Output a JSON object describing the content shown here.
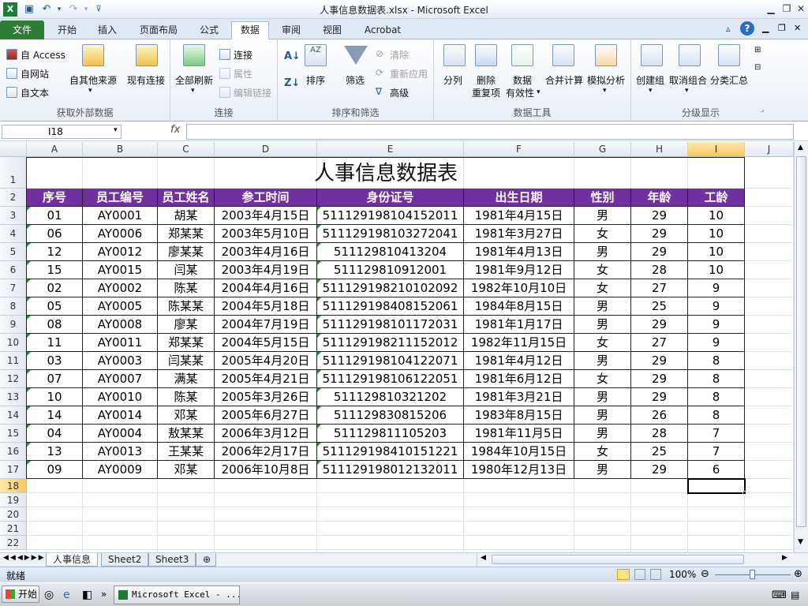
{
  "window": {
    "title": "人事信息数据表.xlsx - Microsoft Excel"
  },
  "tabs": [
    "文件",
    "开始",
    "插入",
    "页面布局",
    "公式",
    "数据",
    "审阅",
    "视图",
    "Acrobat"
  ],
  "ribbon": {
    "ext_group": {
      "label": "获取外部数据",
      "access": "自 Access",
      "web": "自网站",
      "text": "自文本",
      "other": "自其他来源",
      "existing": "现有连接"
    },
    "conn_group": {
      "label": "连接",
      "refresh_all": "全部刷新",
      "connections": "连接",
      "properties": "属性",
      "edit_links": "编辑链接"
    },
    "sort_group": {
      "label": "排序和筛选",
      "sort": "排序",
      "filter": "筛选",
      "clear": "清除",
      "reapply": "重新应用",
      "advanced": "高级"
    },
    "tools_group": {
      "label": "数据工具",
      "split": "分列",
      "remove_dup_1": "删除",
      "remove_dup_2": "重复项",
      "validation_1": "数据",
      "validation_2": "有效性",
      "consolidate": "合并计算",
      "whatif": "模拟分析"
    },
    "outline_group": {
      "label": "分级显示",
      "group": "创建组",
      "ungroup": "取消组合",
      "subtotal": "分类汇总"
    }
  },
  "formula_bar": {
    "name_box": "I18",
    "fx": "fx",
    "content": ""
  },
  "columns": [
    "A",
    "B",
    "C",
    "D",
    "E",
    "F",
    "G",
    "H",
    "I",
    "J"
  ],
  "rows": [
    "1",
    "2",
    "3",
    "4",
    "5",
    "6",
    "7",
    "8",
    "9",
    "10",
    "11",
    "12",
    "13",
    "14",
    "15",
    "16",
    "17",
    "18",
    "19",
    "20",
    "21",
    "22"
  ],
  "sheet": {
    "title": "人事信息数据表",
    "headers": [
      "序号",
      "员工编号",
      "员工姓名",
      "参工时间",
      "身份证号",
      "出生日期",
      "性别",
      "年龄",
      "工龄"
    ],
    "records": [
      [
        "01",
        "AY0001",
        "胡某",
        "2003年4月15日",
        "511129198104152011",
        "1981年4月15日",
        "男",
        "29",
        "10"
      ],
      [
        "06",
        "AY0006",
        "郑某某",
        "2003年5月10日",
        "511129198103272041",
        "1981年3月27日",
        "女",
        "29",
        "10"
      ],
      [
        "12",
        "AY0012",
        "廖某某",
        "2003年4月16日",
        "51112981041320 4",
        "1981年4月13日",
        "男",
        "29",
        "10"
      ],
      [
        "15",
        "AY0015",
        "闫某",
        "2003年4月19日",
        "511129810912001",
        "1981年9月12日",
        "女",
        "28",
        "10"
      ],
      [
        "02",
        "AY0002",
        "陈某",
        "2004年4月16日",
        "511129198210102092",
        "1982年10月10日",
        "女",
        "27",
        "9"
      ],
      [
        "05",
        "AY0005",
        "陈某某",
        "2004年5月18日",
        "511129198408152061",
        "1984年8月15日",
        "男",
        "25",
        "9"
      ],
      [
        "08",
        "AY0008",
        "廖某",
        "2004年7月19日",
        "511129198101172031",
        "1981年1月17日",
        "男",
        "29",
        "9"
      ],
      [
        "11",
        "AY0011",
        "郑某某",
        "2004年5月15日",
        "511129198211152012",
        "1982年11月15日",
        "女",
        "27",
        "9"
      ],
      [
        "03",
        "AY0003",
        "闫某某",
        "2005年4月20日",
        "511129198104122071",
        "1981年4月12日",
        "男",
        "29",
        "8"
      ],
      [
        "07",
        "AY0007",
        "满某",
        "2005年4月21日",
        "511129198106122051",
        "1981年6月12日",
        "女",
        "29",
        "8"
      ],
      [
        "10",
        "AY0010",
        "陈某",
        "2005年3月26日",
        "511129810321202",
        "1981年3月21日",
        "男",
        "29",
        "8"
      ],
      [
        "14",
        "AY0014",
        "邓某",
        "2005年6月27日",
        "511129830815206",
        "1983年8月15日",
        "男",
        "26",
        "8"
      ],
      [
        "04",
        "AY0004",
        "敖某某",
        "2006年3月12日",
        "511129811105203",
        "1981年11月5日",
        "男",
        "28",
        "7"
      ],
      [
        "13",
        "AY0013",
        "王某某",
        "2006年2月17日",
        "511129198410151221",
        "1984年10月15日",
        "女",
        "25",
        "7"
      ],
      [
        "09",
        "AY0009",
        "邓某",
        "2006年10月8日",
        "511129198012132011",
        "1980年12月13日",
        "男",
        "29",
        "6"
      ]
    ]
  },
  "sheet_tabs": [
    "人事信息",
    "Sheet2",
    "Sheet3"
  ],
  "status": {
    "ready": "就绪",
    "zoom": "100%"
  },
  "taskbar": {
    "start": "开始",
    "app": "Microsoft Excel - ..."
  },
  "colors": {
    "header_bg": "#7030a0",
    "file_tab": "#2f7d32",
    "selection": "#f7c95f"
  }
}
